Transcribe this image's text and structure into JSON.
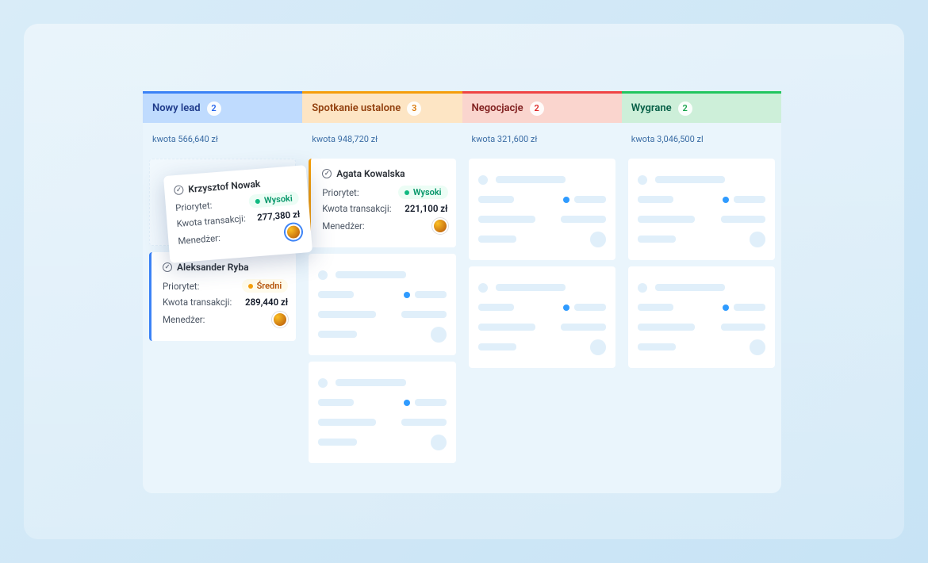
{
  "labels": {
    "priority": "Priorytet:",
    "amount": "Kwota transakcji:",
    "manager": "Menedżer:"
  },
  "priority": {
    "high": "Wysoki",
    "medium": "Średni"
  },
  "columns": [
    {
      "title": "Nowy lead",
      "count": "2",
      "amount": "kwota 566,640 zł",
      "color": "blue"
    },
    {
      "title": "Spotkanie ustalone",
      "count": "3",
      "amount": "kwota 948,720 zł",
      "color": "yellow"
    },
    {
      "title": "Negocjacje",
      "count": "2",
      "amount": "kwota 321,600 zł",
      "color": "red"
    },
    {
      "title": "Wygrane",
      "count": "2",
      "amount": "kwota 3,046,500 zl",
      "color": "green"
    }
  ],
  "cards": {
    "floating": {
      "name": "Krzysztof Nowak",
      "priority": "high",
      "amount": "277,380 zł"
    },
    "col0_card1": {
      "name": "Aleksander Ryba",
      "priority": "medium",
      "amount": "289,440 zł"
    },
    "col1_card0": {
      "name": "Agata Kowalska",
      "priority": "high",
      "amount": "221,100 zł"
    }
  }
}
